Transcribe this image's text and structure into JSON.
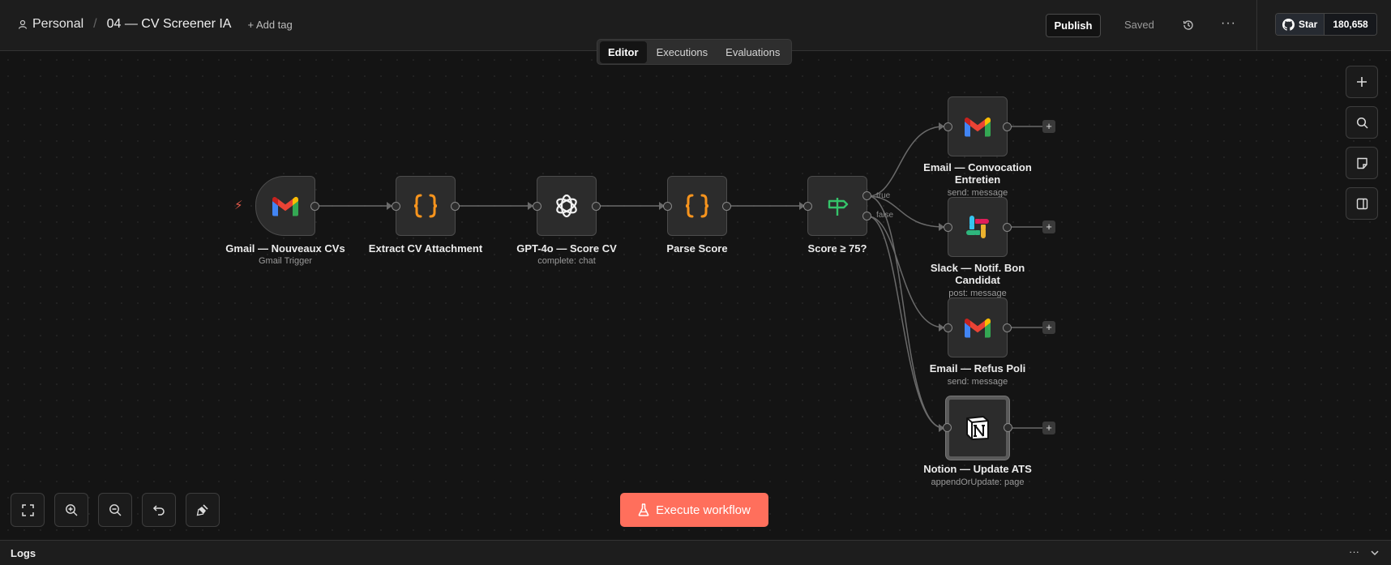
{
  "header": {
    "workspace": "Personal",
    "separator": "/",
    "workflow_name": "04 — CV Screener IA",
    "add_tag": "+ Add tag",
    "publish": "Publish",
    "saved": "Saved",
    "more": "···",
    "github_star": "Star",
    "github_count": "180,658"
  },
  "tabs": [
    {
      "label": "Editor",
      "active": true
    },
    {
      "label": "Executions"
    },
    {
      "label": "Evaluations"
    }
  ],
  "nodes": {
    "gmail_trigger": {
      "title": "Gmail — Nouveaux CVs",
      "subtitle": "Gmail Trigger",
      "icon": "gmail-icon"
    },
    "extract": {
      "title": "Extract CV Attachment",
      "icon": "code-braces-icon"
    },
    "gpt": {
      "title": "GPT-4o — Score CV",
      "subtitle": "complete: chat",
      "icon": "openai-icon"
    },
    "parse": {
      "title": "Parse Score",
      "icon": "code-braces-icon"
    },
    "if": {
      "title": "Score ≥ 75?",
      "icon": "signpost-icon",
      "true_label": "true",
      "false_label": "false"
    },
    "email_conv": {
      "title_l1": "Email — Convocation",
      "title_l2": "Entretien",
      "subtitle": "send: message",
      "icon": "gmail-icon"
    },
    "slack": {
      "title_l1": "Slack — Notif. Bon",
      "title_l2": "Candidat",
      "subtitle": "post: message",
      "icon": "slack-icon"
    },
    "email_refus": {
      "title": "Email — Refus Poli",
      "subtitle": "send: message",
      "icon": "gmail-icon"
    },
    "notion": {
      "title": "Notion — Update ATS",
      "subtitle": "appendOrUpdate: page",
      "icon": "notion-icon"
    }
  },
  "plus_label": "+",
  "execute": {
    "label": "Execute workflow",
    "icon": "flask-icon",
    "color": "#ff6f5c"
  },
  "logs": {
    "title": "Logs",
    "more": "···"
  },
  "colors": {
    "brand": "#ff6f5c",
    "braces": "#f7941d",
    "signpost": "#35c46a"
  }
}
